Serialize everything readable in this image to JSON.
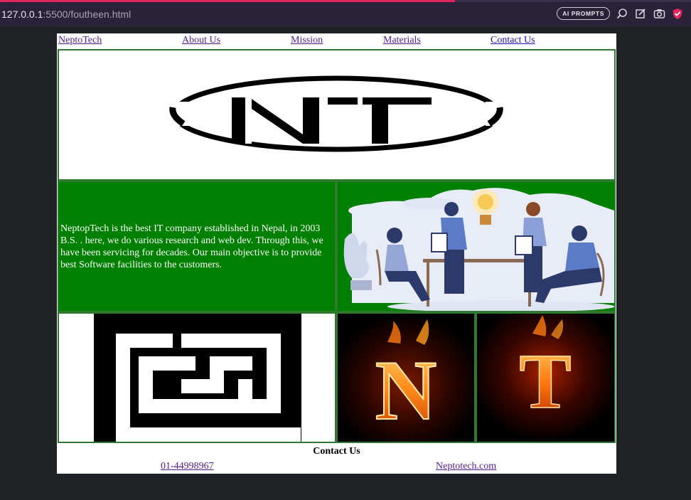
{
  "browser": {
    "url_host": "127.0.0.1",
    "url_path": ":5500/foutheen.html",
    "ai_button": "AI PROMPTS",
    "icons": [
      "search-icon",
      "edit-icon",
      "camera-icon",
      "shield-icon"
    ]
  },
  "nav": {
    "items": [
      {
        "label": "NeptoTech"
      },
      {
        "label": "About Us"
      },
      {
        "label": "Mission"
      },
      {
        "label": "Materials"
      },
      {
        "label": "Contact Us"
      }
    ]
  },
  "logo": {
    "letters": "NT"
  },
  "about": {
    "text": "NeptopTech is the best IT company established in Nepal, in 2003 B.S. . here, we do various research and web dev. Through this, we have been servicing for decades. Our main objective is to provide best Software facilities to the customers."
  },
  "fire_letters": {
    "first": "N",
    "second": "T"
  },
  "footer": {
    "title": "Contact Us",
    "phone": "01-44998967",
    "site": "Neptotech.com"
  },
  "colors": {
    "green": "#008000",
    "border": "#2f7a2f",
    "link": "#1a0dab",
    "visited": "#551a8b",
    "chrome_bg": "#2a2238",
    "accent": "#e0245e"
  }
}
